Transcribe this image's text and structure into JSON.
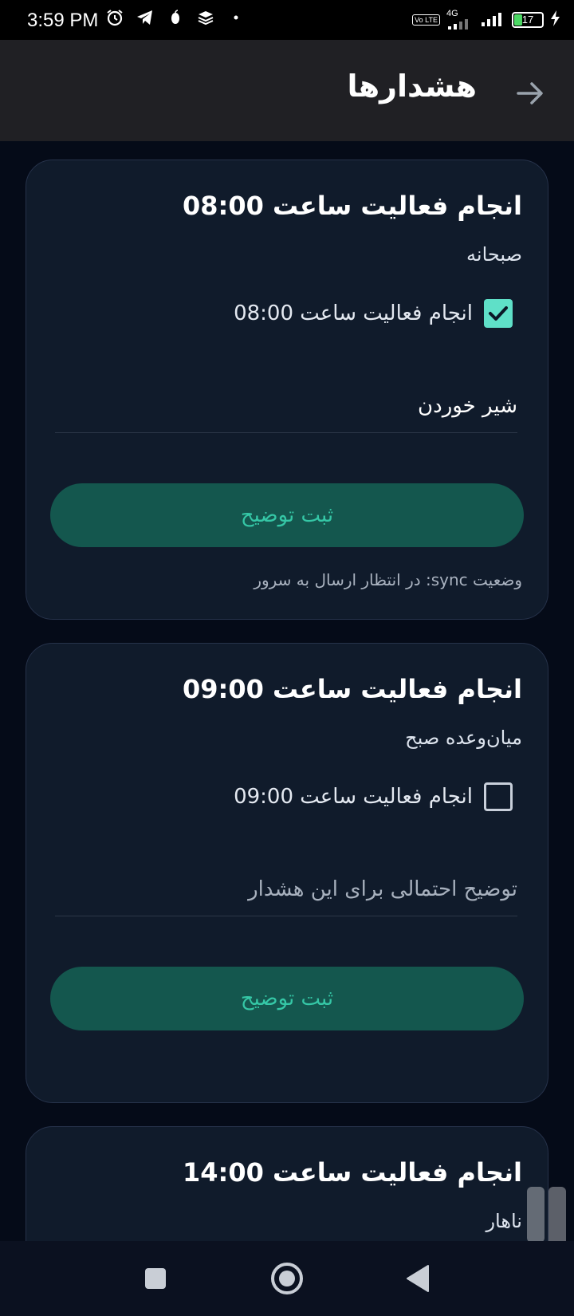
{
  "status_bar": {
    "time": "3:59 PM",
    "network": "4G",
    "volte": "Vo LTE",
    "battery": "17"
  },
  "header": {
    "title": "هشدارها",
    "back_icon": "arrow-right-icon"
  },
  "cards": [
    {
      "title": "انجام فعالیت ساعت 08:00",
      "subtitle": "صبحانه",
      "checkbox_label": "انجام فعالیت ساعت 08:00",
      "checked": true,
      "note_value": "شیر خوردن",
      "note_placeholder": "",
      "button_label": "ثبت توضیح",
      "sync_status": "وضعیت sync: در انتظار ارسال به سرور"
    },
    {
      "title": "انجام فعالیت ساعت 09:00",
      "subtitle": "میان‌وعده صبح",
      "checkbox_label": "انجام فعالیت ساعت 09:00",
      "checked": false,
      "note_value": "",
      "note_placeholder": "توضیح احتمالی برای این هشدار",
      "button_label": "ثبت توضیح",
      "sync_status": ""
    },
    {
      "title": "انجام فعالیت ساعت 14:00",
      "subtitle": "ناهار"
    }
  ],
  "nav_bar": {
    "recents_icon": "square-icon",
    "home_icon": "circle-icon",
    "back_icon": "triangle-back-icon"
  },
  "colors": {
    "background": "#050b18",
    "card": "#101b2b",
    "accent": "#5fe0c8",
    "button_bg": "#14574e",
    "button_text": "#35c7a6"
  }
}
